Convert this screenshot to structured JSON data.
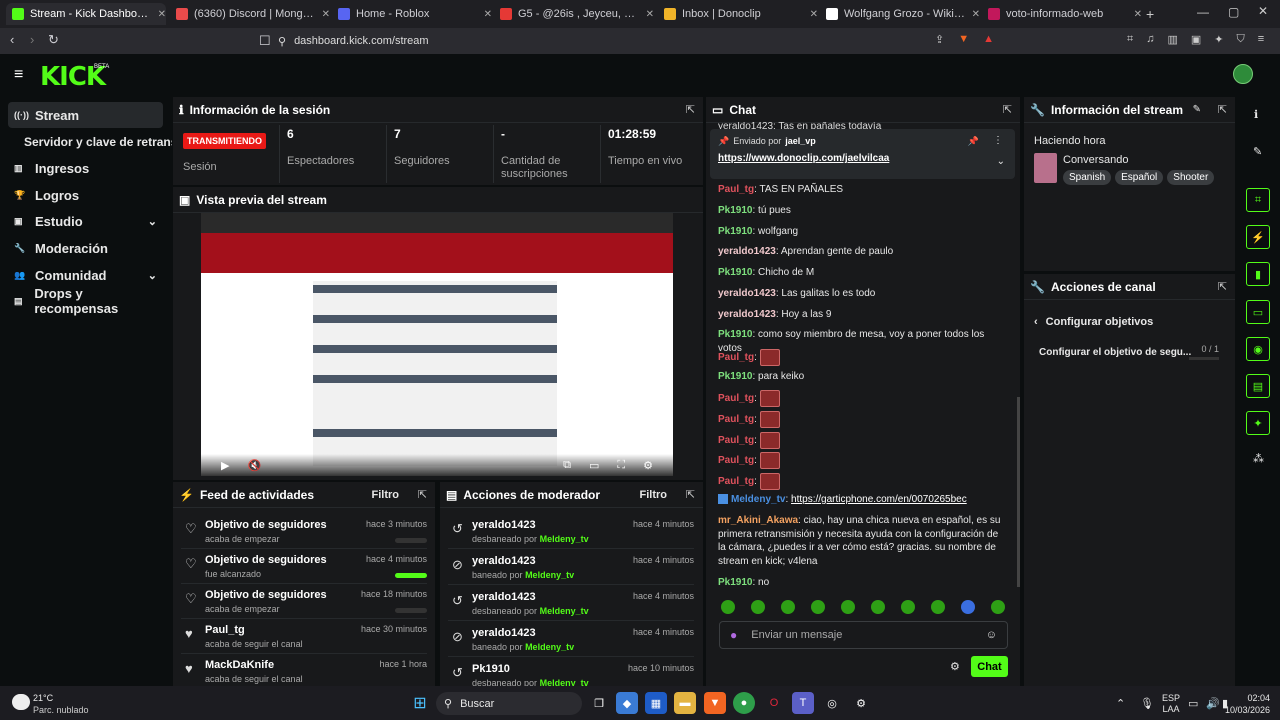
{
  "browser": {
    "tabs": [
      {
        "label": "Stream - Kick Dashboard",
        "color": "#53fc18"
      },
      {
        "label": "(6360) Discord | Mongolrux",
        "color": "#e94b4b"
      },
      {
        "label": "Home - Roblox",
        "color": "#5865f2"
      },
      {
        "label": "G5 - @26is , Jeyceu, Jaico.40, LilC",
        "color": "#e53935"
      },
      {
        "label": "Inbox | Donoclip",
        "color": "#f0b429"
      },
      {
        "label": "Wolfgang Grozo - Wikipedia, la encic",
        "color": "#ffffff"
      },
      {
        "label": "voto-informado-web",
        "color": "#c2185b"
      }
    ],
    "url": "dashboard.kick.com/stream"
  },
  "kick": {
    "logo": "KICK",
    "beta": "BETA"
  },
  "sidebar": {
    "items": [
      {
        "label": "Stream",
        "icon": "stream-icon"
      },
      {
        "label": "Servidor y clave de retransmisión",
        "icon": ""
      },
      {
        "label": "Ingresos",
        "icon": "chart-icon"
      },
      {
        "label": "Logros",
        "icon": "trophy-icon"
      },
      {
        "label": "Estudio",
        "icon": "studio-icon"
      },
      {
        "label": "Moderación",
        "icon": "wrench-icon"
      },
      {
        "label": "Comunidad",
        "icon": "people-icon"
      },
      {
        "label": "Drops y recompensas",
        "icon": "gift-icon"
      }
    ]
  },
  "session": {
    "title": "Información de la sesión",
    "status": "TRANSMITIENDO",
    "status_label": "Sesión",
    "stats": [
      {
        "value": "6",
        "label": "Espectadores"
      },
      {
        "value": "7",
        "label": "Seguidores"
      },
      {
        "value": "-",
        "label": "Cantidad de suscripciones"
      },
      {
        "value": "01:28:59",
        "label": "Tiempo en vivo"
      }
    ]
  },
  "preview": {
    "title": "Vista previa del stream"
  },
  "activity": {
    "title": "Feed de actividades",
    "filter": "Filtro",
    "items": [
      {
        "title": "Objetivo de seguidores",
        "sub": "acaba de empezar",
        "time": "hace 3 minutos",
        "progress": 0
      },
      {
        "title": "Objetivo de seguidores",
        "sub": "fue alcanzado",
        "time": "hace 4 minutos",
        "progress": 1
      },
      {
        "title": "Objetivo de seguidores",
        "sub": "acaba de empezar",
        "time": "hace 18 minutos",
        "progress": 0
      },
      {
        "title": "Paul_tg",
        "sub": "acaba de seguir el canal",
        "time": "hace 30 minutos",
        "progress": null
      },
      {
        "title": "MackDaKnife",
        "sub": "acaba de seguir el canal",
        "time": "hace 1 hora",
        "progress": null
      }
    ]
  },
  "modactions": {
    "title": "Acciones de moderador",
    "filter": "Filtro",
    "items": [
      {
        "user": "yeraldo1423",
        "action": "desbaneado por",
        "by": "Meldeny_tv",
        "time": "hace 4 minutos"
      },
      {
        "user": "yeraldo1423",
        "action": "baneado por",
        "by": "Meldeny_tv",
        "time": "hace 4 minutos"
      },
      {
        "user": "yeraldo1423",
        "action": "desbaneado por",
        "by": "Meldeny_tv",
        "time": "hace 4 minutos"
      },
      {
        "user": "yeraldo1423",
        "action": "baneado por",
        "by": "Meldeny_tv",
        "time": "hace 4 minutos"
      },
      {
        "user": "Pk1910",
        "action": "desbaneado por",
        "by": "Meldeny_tv",
        "time": "hace 10 minutos"
      }
    ]
  },
  "chat": {
    "title": "Chat",
    "pinned_top": "yeraldo1423: Tas en pañales todavía",
    "pinned_by_label": "Enviado por",
    "pinned_by": "jael_vp",
    "pinned_link": "https://www.donoclip.com/jaelvilcaa",
    "messages": [
      {
        "user": "Paul_tg",
        "color": "#e0525d",
        "text": "TAS EN PAÑALES",
        "emote": false
      },
      {
        "user": "Pk1910",
        "color": "#7ee07e",
        "text": "tú pues",
        "emote": false
      },
      {
        "user": "Pk1910",
        "color": "#7ee07e",
        "text": "wolfgang",
        "emote": false
      },
      {
        "user": "yeraldo1423",
        "color": "#f0c8cc",
        "text": "Aprendan gente de paulo",
        "emote": false
      },
      {
        "user": "Pk1910",
        "color": "#7ee07e",
        "text": "Chicho de M",
        "emote": false
      },
      {
        "user": "yeraldo1423",
        "color": "#f0c8cc",
        "text": "Las galitas lo es todo",
        "emote": false
      },
      {
        "user": "yeraldo1423",
        "color": "#f0c8cc",
        "text": "Hoy a las 9",
        "emote": false
      },
      {
        "user": "Pk1910",
        "color": "#7ee07e",
        "text": "como soy miembro de mesa, voy a poner todos los votos",
        "emote": false
      },
      {
        "user": "Paul_tg",
        "color": "#e0525d",
        "text": "",
        "emote": true
      },
      {
        "user": "Pk1910",
        "color": "#7ee07e",
        "text": "para keiko",
        "emote": false
      },
      {
        "user": "Paul_tg",
        "color": "#e0525d",
        "text": "",
        "emote": true
      },
      {
        "user": "Paul_tg",
        "color": "#e0525d",
        "text": "",
        "emote": true
      },
      {
        "user": "Paul_tg",
        "color": "#e0525d",
        "text": "",
        "emote": true
      },
      {
        "user": "Paul_tg",
        "color": "#e0525d",
        "text": "",
        "emote": true
      },
      {
        "user": "Paul_tg",
        "color": "#e0525d",
        "text": "",
        "emote": true
      },
      {
        "user": "Meldeny_tv",
        "color": "#4a90e2",
        "text": "https://garticphone.com/en/0070265bec",
        "emote": false
      },
      {
        "user": "mr_Akini_Akawa",
        "color": "#f4a261",
        "text": "ciao, hay una chica nueva en español, es su primera retransmisión y necesita ayuda con la configuración de la cámara, ¿puedes ir a ver cómo está? gracias. su nombre de stream en kick; v4lena",
        "emote": false
      },
      {
        "user": "Pk1910",
        "color": "#7ee07e",
        "text": "no",
        "emote": false
      }
    ],
    "input_placeholder": "Enviar un mensaje",
    "send": "Chat"
  },
  "streaminfo": {
    "title": "Información del stream",
    "stream_title": "Haciendo hora",
    "category": "Conversando",
    "tags": [
      "Spanish",
      "Español",
      "Shooter"
    ]
  },
  "channel": {
    "title": "Acciones de canal",
    "back": "Configurar objetivos",
    "goal_label": "Configurar el objetivo de segu...",
    "goal_value": "0 / 1"
  },
  "taskbar": {
    "weather_temp": "21°C",
    "weather_desc": "Parc. nublado",
    "search": "Buscar",
    "lang1": "ESP",
    "lang2": "LAA",
    "time": "02:04",
    "date": "10/03/2026"
  }
}
